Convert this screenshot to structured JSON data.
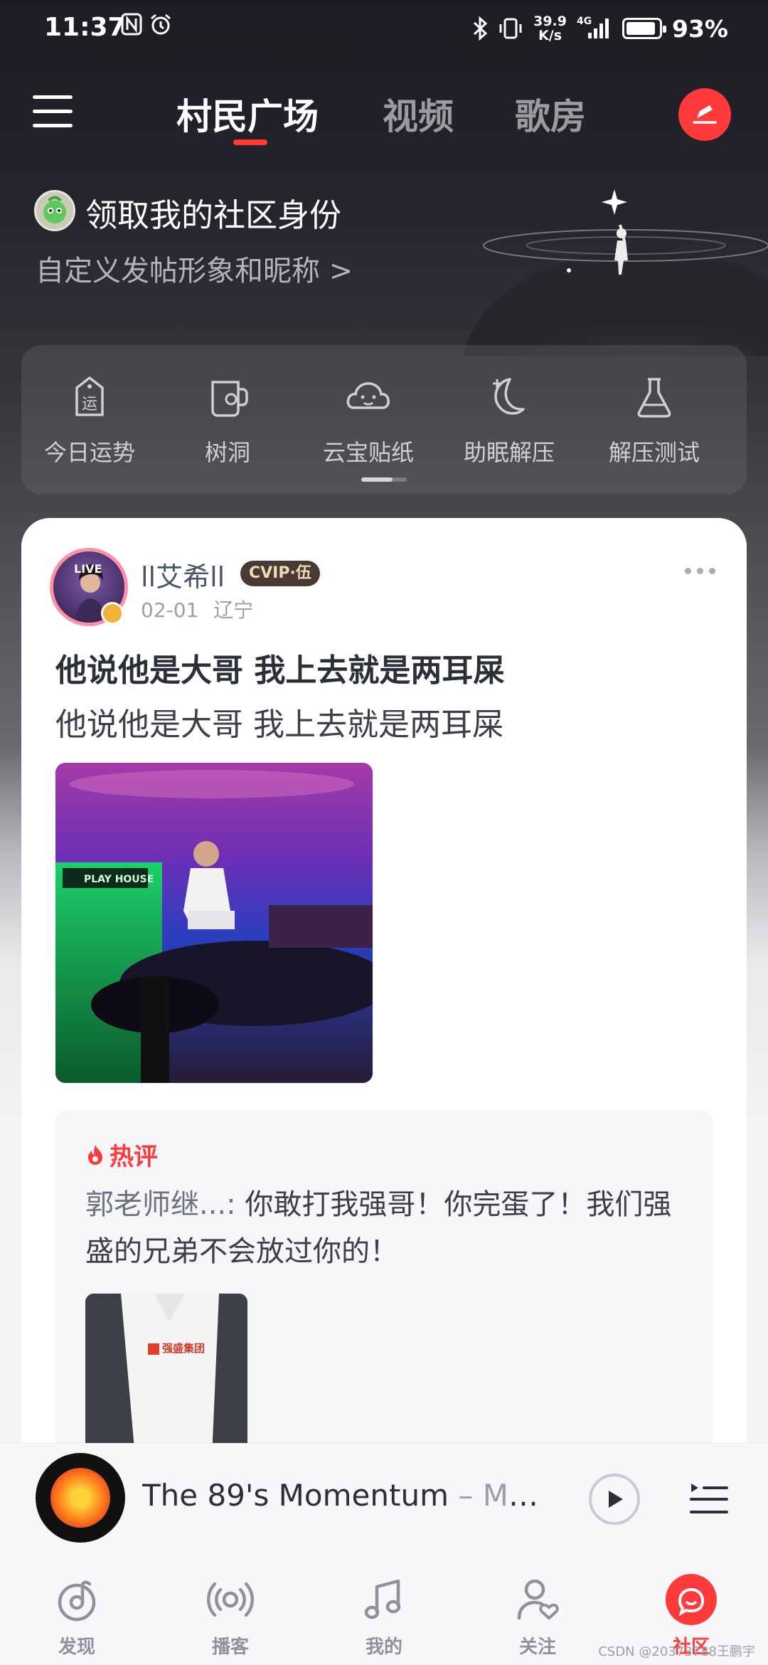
{
  "status_bar": {
    "time": "11:37",
    "net_speed_top": "39.9",
    "net_speed_bottom": "K/s",
    "network": "4G",
    "battery": "93%"
  },
  "header": {
    "tabs": [
      {
        "label": "村民广场",
        "active": true
      },
      {
        "label": "视频",
        "active": false
      },
      {
        "label": "歌房",
        "active": false
      }
    ],
    "accent_color": "#ff3a3a"
  },
  "identity": {
    "title": "领取我的社区身份",
    "subtitle": "自定义发帖形象和昵称",
    "subtitle_arrow": ">"
  },
  "shortcuts": [
    {
      "label": "今日运势",
      "icon": "fortune-tag-icon",
      "glyph": "运"
    },
    {
      "label": "树洞",
      "icon": "mug-icon"
    },
    {
      "label": "云宝贴纸",
      "icon": "cloud-face-icon"
    },
    {
      "label": "助眠解压",
      "icon": "moon-icon"
    },
    {
      "label": "解压测试",
      "icon": "flask-icon"
    }
  ],
  "post": {
    "author": "ll艾希ll",
    "live_tag": "LIVE",
    "vip_badge": "CVIP·伍",
    "date": "02-01",
    "location": "辽宁",
    "title": "他说他是大哥  我上去就是两耳屎",
    "body": "他说他是大哥  我上去就是两耳屎",
    "image_sign": "PLAY HOUSE",
    "hot_comment": {
      "label": "热评",
      "user": "郭老师继...:",
      "text": " 你敢打我强哥！你完蛋了！我们强盛的兄弟不会放过你的！",
      "image_logo": "强盛集团"
    }
  },
  "player": {
    "song": "The 89's Momentum",
    "separator": " – ",
    "artist": "MYU..."
  },
  "bottom_nav": [
    {
      "label": "发现",
      "icon": "discover-icon",
      "active": false
    },
    {
      "label": "播客",
      "icon": "podcast-icon",
      "active": false
    },
    {
      "label": "我的",
      "icon": "music-note-icon",
      "active": false
    },
    {
      "label": "关注",
      "icon": "follow-icon",
      "active": false
    },
    {
      "label": "社区",
      "icon": "community-icon",
      "active": true
    }
  ],
  "watermark": "CSDN @20373788王鹏宇"
}
